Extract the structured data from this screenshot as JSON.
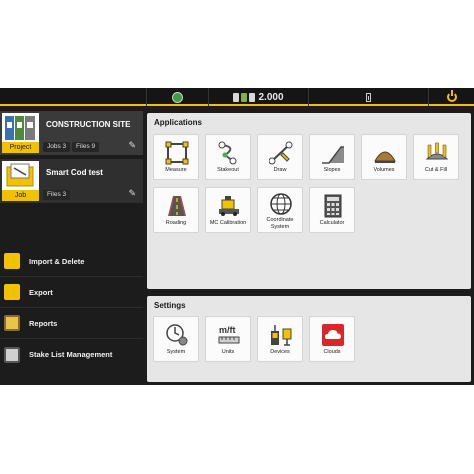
{
  "status_bar": {
    "gnss_value": "2.000"
  },
  "project": {
    "title": "CONSTRUCTION SITE",
    "tag": "Project",
    "jobs_chip": "Jobs 3",
    "files_chip": "Files 9"
  },
  "job": {
    "title": "Smart Cod test",
    "tag": "Job",
    "files_chip": "Files 3"
  },
  "menu": {
    "import_delete": "Import & Delete",
    "export": "Export",
    "reports": "Reports",
    "stake_list": "Stake List Management"
  },
  "applications": {
    "title": "Applications",
    "tiles": [
      {
        "label": "Measure",
        "icon": "measure-icon"
      },
      {
        "label": "Stakeout",
        "icon": "stakeout-icon"
      },
      {
        "label": "Draw",
        "icon": "draw-icon"
      },
      {
        "label": "Slopes",
        "icon": "slopes-icon"
      },
      {
        "label": "Volumes",
        "icon": "volumes-icon"
      },
      {
        "label": "Cut & Fill",
        "icon": "cut-fill-icon"
      },
      {
        "label": "Roading",
        "icon": "roading-icon"
      },
      {
        "label": "MC Calibration",
        "icon": "mc-calibration-icon"
      },
      {
        "label": "Coordinate System",
        "icon": "coordinate-system-icon"
      },
      {
        "label": "Calculator",
        "icon": "calculator-icon"
      }
    ]
  },
  "settings": {
    "title": "Settings",
    "tiles": [
      {
        "label": "System",
        "icon": "system-icon"
      },
      {
        "label": "Units",
        "icon": "units-icon"
      },
      {
        "label": "Devices",
        "icon": "devices-icon"
      },
      {
        "label": "Clouds",
        "icon": "clouds-icon"
      }
    ]
  },
  "colors": {
    "accent": "#f2c200",
    "background": "#1c1c1c",
    "panel": "#e6e6e6",
    "clouds_red": "#d9262b"
  }
}
